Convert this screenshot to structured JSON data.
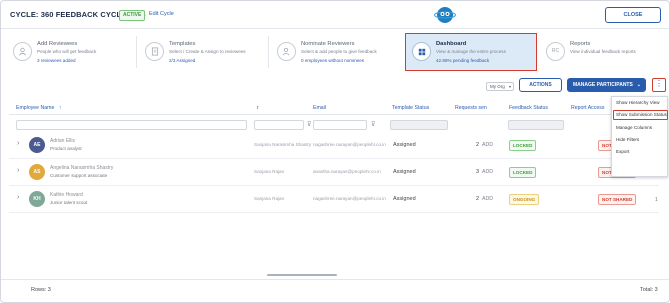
{
  "header": {
    "cycle_title": "CYCLE: 360 FEEDBACK CYCLE 2025",
    "status_badge": "ACTIVE",
    "edit_link": "Edit Cycle",
    "close_label": "CLOSE"
  },
  "steps": [
    {
      "title": "Add Reviewees",
      "desc": "People who will get feedback",
      "link": "3 reviewees added"
    },
    {
      "title": "Templates",
      "desc": "Select / Create & Assign to reviewees",
      "link": "2/3 Assigned"
    },
    {
      "title": "Nominate Reviewers",
      "desc": "Select & add people to give feedback",
      "link": "0 employees without nominees"
    },
    {
      "title": "Dashboard",
      "desc": "View & manage the entire process",
      "link": "42.86% pending feedback"
    },
    {
      "title": "Reports",
      "desc": "View individual feedback reports",
      "link": ""
    }
  ],
  "toolbar": {
    "org_select": "My Org",
    "actions_label": "ACTIONS",
    "manage_label": "MANAGE PARTICIPANTS",
    "kebab": "⋮"
  },
  "table": {
    "columns": {
      "employee_name": "Employee Name",
      "manager": "r",
      "email": "Email",
      "template_status": "Template Status",
      "requests": "Requests sen",
      "feedback_status": "Feedback Status",
      "report_access": "Report Access"
    },
    "rows": [
      {
        "initials": "AE",
        "avatar_color": "#4b5a8f",
        "name": "Adrian Ellis",
        "role": "Product analyst",
        "manager": "Sanjana Narasimha Shastry",
        "email": "nagashree.narayan@peoplehr.co.in",
        "template_status": "Assigned",
        "requests": "2",
        "add_label": "ADD",
        "feedback_status": "LOCKED",
        "report_access": "NOT SHARED",
        "count": "1"
      },
      {
        "initials": "AS",
        "avatar_color": "#e0a93a",
        "name": "Angelina Narasimha Shastry",
        "role": "Customer support associate",
        "manager": "Sanjana Rajan",
        "email": "anantha.narayan@peoplehr.co.in",
        "template_status": "Assigned",
        "requests": "3",
        "add_label": "ADD",
        "feedback_status": "LOCKED",
        "report_access": "NOT SHARED",
        "count": "1"
      },
      {
        "initials": "KH",
        "avatar_color": "#7fa898",
        "name": "Kathie Howard",
        "role": "Junior talent scout",
        "manager": "Sanjana Rajan",
        "email": "nagashree.narayan@peoplehr.co.in",
        "template_status": "Assigned",
        "requests": "2",
        "add_label": "ADD",
        "feedback_status": "ONGOING",
        "report_access": "NOT SHARED",
        "count": "1"
      }
    ]
  },
  "menu": {
    "items": [
      "Show Hierarchy View",
      "Show Submission Status",
      "Manage Columns",
      "Hide Filters",
      "Export"
    ]
  },
  "footer": {
    "rows_label": "Rows: 3",
    "total_label": "Total: 3"
  }
}
